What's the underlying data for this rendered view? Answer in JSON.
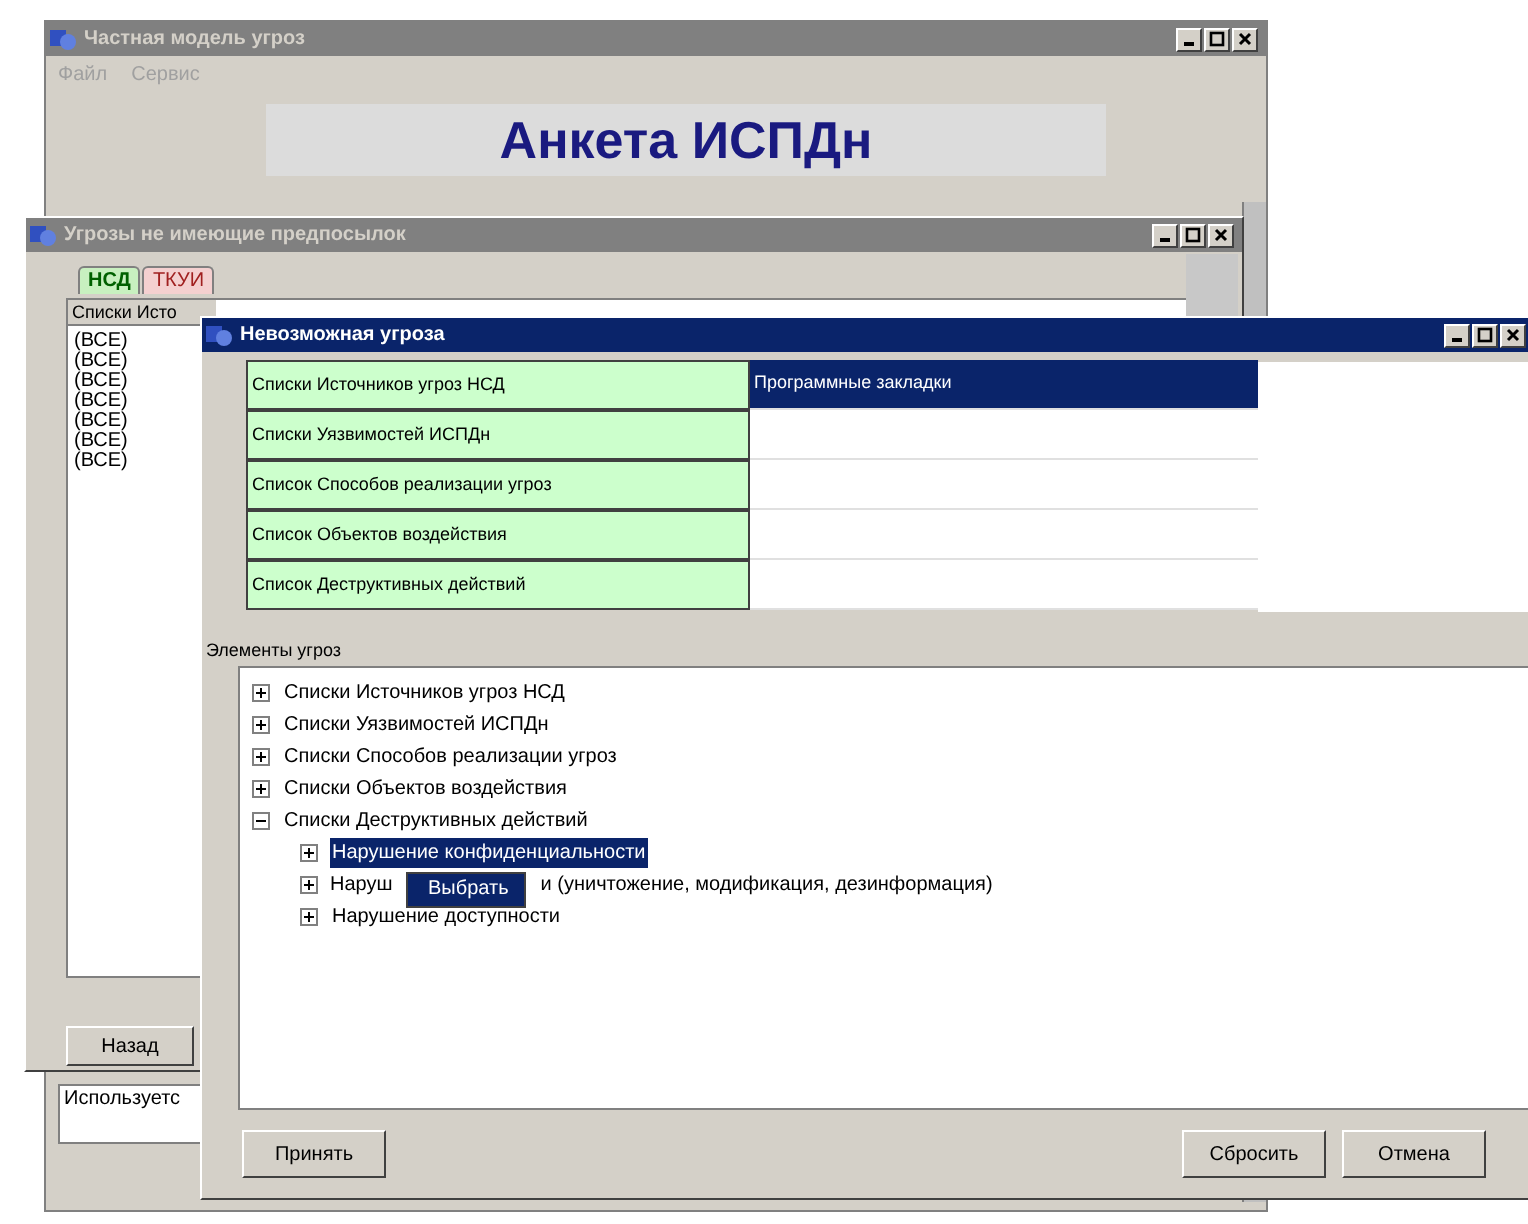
{
  "main_window": {
    "title": "Частная модель угроз",
    "menu": [
      "Файл",
      "Сервис"
    ],
    "heading": "Анкета ИСПДн",
    "field_text": "Используетс"
  },
  "threats_window": {
    "title": "Угрозы не имеющие предпосылок",
    "tabs": [
      {
        "label": "НСД",
        "selected": true
      },
      {
        "label": "ТКУИ",
        "selected": false
      }
    ],
    "column_1": "Списки Исто",
    "rows": [
      "(ВСЕ)",
      "(ВСЕ)",
      "(ВСЕ)",
      "(ВСЕ)",
      "(ВСЕ)",
      "(ВСЕ)",
      "(ВСЕ)"
    ],
    "back_button": "Назад"
  },
  "dialog": {
    "title": "Невозможная угроза",
    "grid": [
      {
        "label": "Списки Источников угроз НСД",
        "value": "Программные закладки",
        "selected": true
      },
      {
        "label": "Списки Уязвимостей ИСПДн",
        "selected": false
      },
      {
        "label": "Список Способов реализации угроз",
        "selected": false
      },
      {
        "label": "Список Объектов воздействия",
        "selected": false
      },
      {
        "label": "Список Деструктивных действий",
        "selected": false
      }
    ],
    "tree_label": "Элементы угроз",
    "tree": [
      {
        "label": "Списки Источников угроз НСД",
        "expanded": false,
        "selected": false
      },
      {
        "label": "Списки Уязвимостей ИСПДн",
        "expanded": false,
        "selected": false
      },
      {
        "label": "Списки Способов реализации угроз",
        "expanded": false,
        "selected": false
      },
      {
        "label": "Списки Объектов воздействия",
        "expanded": false,
        "selected": false
      },
      {
        "label": "Списки Деструктивных действий",
        "expanded": true,
        "selected": false,
        "children": [
          {
            "label": "Нарушение конфиденциальности",
            "expanded": false,
            "selected": true
          },
          {
            "label_parts": [
              "Наруш",
              "и (уничтожение, модификация, дезинформация)"
            ],
            "expanded": false,
            "selected": false
          },
          {
            "label": "Нарушение  доступности",
            "expanded": false,
            "selected": false
          }
        ]
      }
    ],
    "context_menu": [
      "Выбрать"
    ],
    "buttons": [
      "Принять",
      "Сбросить",
      "Отмена"
    ]
  }
}
